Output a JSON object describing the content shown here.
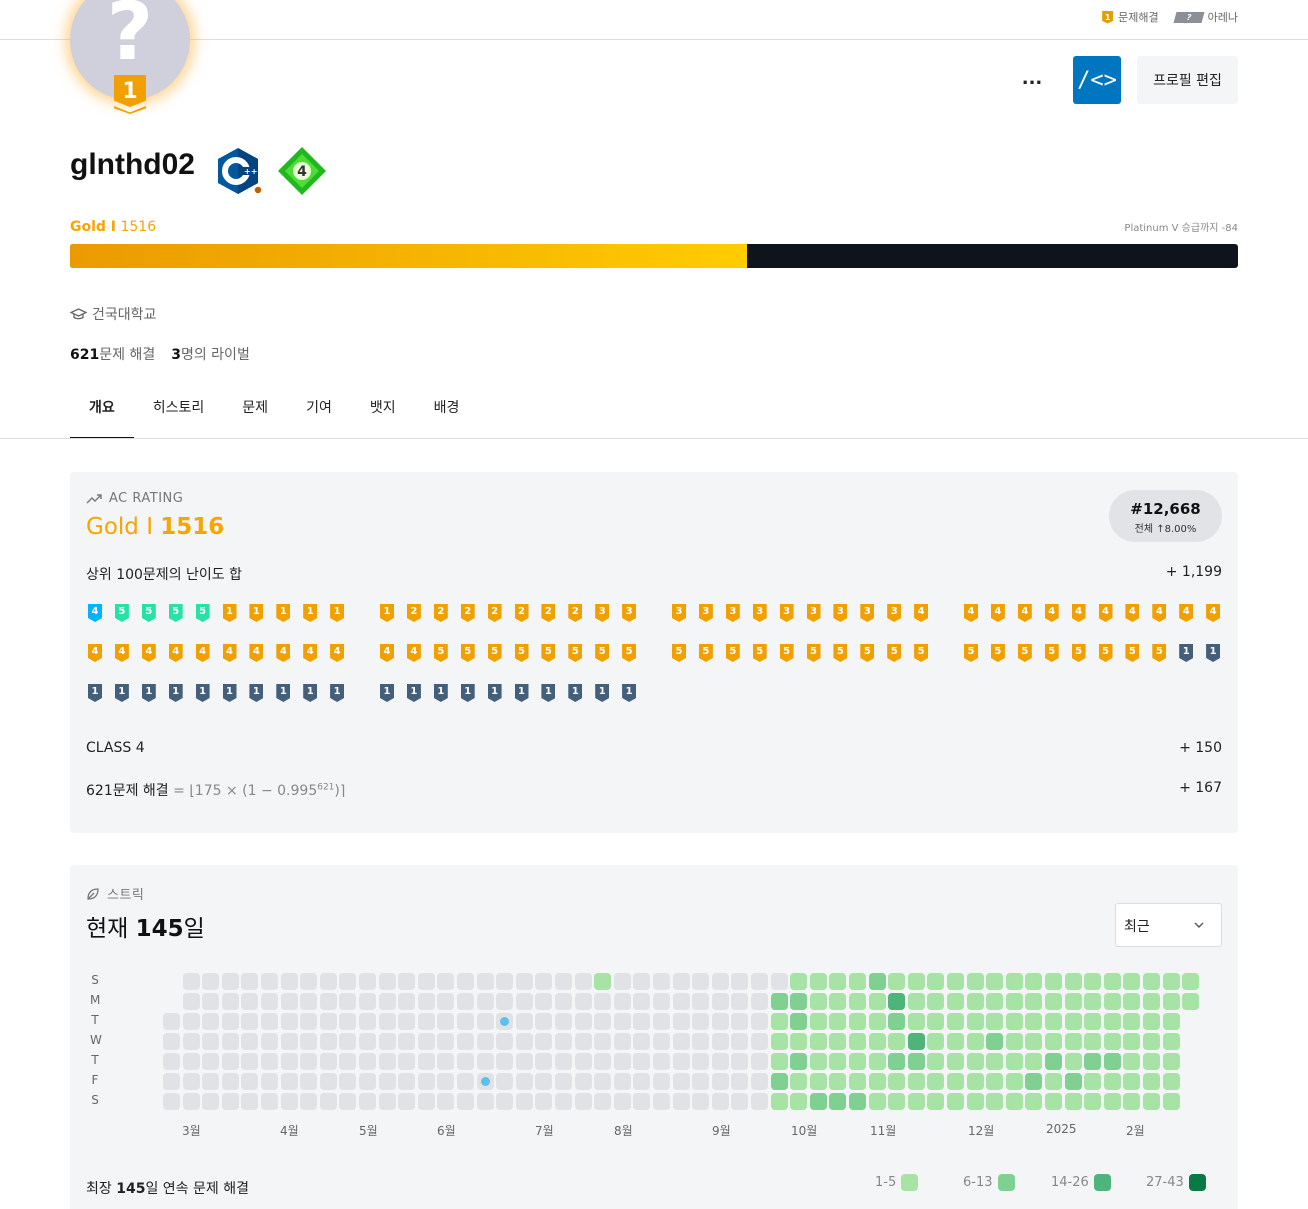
{
  "topbar": {
    "solve_tier": "1",
    "solve_label": "문제해결",
    "arena_tier": "?",
    "arena_label": "아레나"
  },
  "avatar": {
    "glyph": "?",
    "tier": "1"
  },
  "header": {
    "more_label": "...",
    "code_label": "/<>",
    "edit_label": "프로필 편집"
  },
  "profile": {
    "username": "glnthd02",
    "level_badge": "4",
    "tier_name": "Gold I",
    "tier_rating": "1516",
    "next_tier": "Platinum V 승급까지 -84",
    "progress_fraction": 0.58,
    "school": "건국대학교",
    "solved_count": "621",
    "solved_suffix": "문제 해결",
    "rival_count": "3",
    "rival_suffix": "명의 라이벌"
  },
  "tabs": [
    {
      "label": "개요",
      "active": true
    },
    {
      "label": "히스토리"
    },
    {
      "label": "문제"
    },
    {
      "label": "기여"
    },
    {
      "label": "뱃지"
    },
    {
      "label": "배경"
    }
  ],
  "ac_rating": {
    "section_title": "AC RATING",
    "tier_name": "Gold I",
    "tier_rating": "1516",
    "rank": "#12,668",
    "rank_sub": "전체 ↑8.00%",
    "top100_label": "상위 100문제의 난이도 합",
    "top100_value": "+ 1,199",
    "class_label": "CLASS 4",
    "class_value": "+ 150",
    "solved_label": "621문제 해결",
    "solved_formula": "= ⌊175 × (1 − 0.995",
    "solved_exp": "621",
    "solved_tail": ")⌉",
    "solved_value": "+ 167",
    "colors": {
      "gold": "#f0a000",
      "platinum": "#27e2a4",
      "diamond": "#00b4fc",
      "silver": "#435f7a"
    },
    "problem_tiers": [
      [
        [
          "d",
          4
        ],
        [
          "p",
          5
        ],
        [
          "p",
          5
        ],
        [
          "p",
          5
        ],
        [
          "p",
          5
        ],
        [
          "g",
          1
        ],
        [
          "g",
          1
        ],
        [
          "g",
          1
        ],
        [
          "g",
          1
        ],
        [
          "g",
          1
        ]
      ],
      [
        [
          "g",
          1
        ],
        [
          "g",
          2
        ],
        [
          "g",
          2
        ],
        [
          "g",
          2
        ],
        [
          "g",
          2
        ],
        [
          "g",
          2
        ],
        [
          "g",
          2
        ],
        [
          "g",
          2
        ],
        [
          "g",
          3
        ],
        [
          "g",
          3
        ]
      ],
      [
        [
          "g",
          3
        ],
        [
          "g",
          3
        ],
        [
          "g",
          3
        ],
        [
          "g",
          3
        ],
        [
          "g",
          3
        ],
        [
          "g",
          3
        ],
        [
          "g",
          3
        ],
        [
          "g",
          3
        ],
        [
          "g",
          3
        ],
        [
          "g",
          4
        ]
      ],
      [
        [
          "g",
          4
        ],
        [
          "g",
          4
        ],
        [
          "g",
          4
        ],
        [
          "g",
          4
        ],
        [
          "g",
          4
        ],
        [
          "g",
          4
        ],
        [
          "g",
          4
        ],
        [
          "g",
          4
        ],
        [
          "g",
          4
        ],
        [
          "g",
          4
        ]
      ],
      [
        [
          "g",
          4
        ],
        [
          "g",
          4
        ],
        [
          "g",
          4
        ],
        [
          "g",
          4
        ],
        [
          "g",
          4
        ],
        [
          "g",
          4
        ],
        [
          "g",
          4
        ],
        [
          "g",
          4
        ],
        [
          "g",
          4
        ],
        [
          "g",
          4
        ]
      ],
      [
        [
          "g",
          4
        ],
        [
          "g",
          4
        ],
        [
          "g",
          5
        ],
        [
          "g",
          5
        ],
        [
          "g",
          5
        ],
        [
          "g",
          5
        ],
        [
          "g",
          5
        ],
        [
          "g",
          5
        ],
        [
          "g",
          5
        ],
        [
          "g",
          5
        ]
      ],
      [
        [
          "g",
          5
        ],
        [
          "g",
          5
        ],
        [
          "g",
          5
        ],
        [
          "g",
          5
        ],
        [
          "g",
          5
        ],
        [
          "g",
          5
        ],
        [
          "g",
          5
        ],
        [
          "g",
          5
        ],
        [
          "g",
          5
        ],
        [
          "g",
          5
        ]
      ],
      [
        [
          "g",
          5
        ],
        [
          "g",
          5
        ],
        [
          "g",
          5
        ],
        [
          "g",
          5
        ],
        [
          "g",
          5
        ],
        [
          "g",
          5
        ],
        [
          "g",
          5
        ],
        [
          "g",
          5
        ],
        [
          "s",
          1
        ],
        [
          "s",
          1
        ]
      ],
      [
        [
          "s",
          1
        ],
        [
          "s",
          1
        ],
        [
          "s",
          1
        ],
        [
          "s",
          1
        ],
        [
          "s",
          1
        ],
        [
          "s",
          1
        ],
        [
          "s",
          1
        ],
        [
          "s",
          1
        ],
        [
          "s",
          1
        ],
        [
          "s",
          1
        ]
      ],
      [
        [
          "s",
          1
        ],
        [
          "s",
          1
        ],
        [
          "s",
          1
        ],
        [
          "s",
          1
        ],
        [
          "s",
          1
        ],
        [
          "s",
          1
        ],
        [
          "s",
          1
        ],
        [
          "s",
          1
        ],
        [
          "s",
          1
        ],
        [
          "s",
          1
        ]
      ]
    ]
  },
  "streak": {
    "section_title": "스트릭",
    "current_prefix": "현재 ",
    "current_days": "145",
    "current_suffix": "일",
    "dropdown_value": "최근",
    "weekdays": [
      "S",
      "M",
      "T",
      "W",
      "T",
      "F",
      "S"
    ],
    "months": [
      "3월",
      "4월",
      "5월",
      "6월",
      "7월",
      "8월",
      "9월",
      "10월",
      "11월",
      "12월",
      "2025",
      "2월"
    ],
    "longest_prefix": "최장 ",
    "longest_days": "145",
    "longest_suffix": "일 연속 문제 해결",
    "legend": [
      {
        "label": "1-5",
        "color": "#a6e3a5"
      },
      {
        "label": "6-13",
        "color": "#7fd091"
      },
      {
        "label": "14-26",
        "color": "#4fb479"
      },
      {
        "label": "27-43",
        "color": "#0a7a45"
      }
    ],
    "empty_color": "#e1e2e5",
    "freeze_color": "#5bc0eb",
    "week_count": 53,
    "first_day_week0": 2,
    "last_week_days": 2,
    "active_from_week": 31,
    "levels": {
      "31": [
        0,
        2,
        1,
        1,
        1,
        2,
        1
      ],
      "32": [
        1,
        2,
        2,
        1,
        2,
        1,
        1
      ],
      "34": [
        1,
        1,
        1,
        1,
        1,
        1,
        2
      ],
      "35": [
        1,
        1,
        1,
        1,
        1,
        1,
        2
      ],
      "36": [
        2,
        1,
        1,
        1,
        1,
        1,
        1
      ],
      "37": [
        1,
        3,
        2,
        1,
        2,
        1,
        1
      ],
      "38": [
        1,
        1,
        1,
        3,
        2,
        1,
        1
      ],
      "42": [
        1,
        1,
        1,
        2,
        1,
        1,
        1
      ],
      "44": [
        1,
        1,
        1,
        1,
        1,
        2,
        1
      ],
      "45": [
        1,
        1,
        1,
        1,
        2,
        1,
        1
      ],
      "46": [
        1,
        1,
        1,
        1,
        1,
        2,
        1
      ],
      "47": [
        1,
        1,
        1,
        1,
        2,
        1,
        1
      ],
      "48": [
        1,
        1,
        1,
        1,
        2,
        1,
        1
      ]
    },
    "single_cells": [
      {
        "week": 22,
        "day": 0,
        "level": 1
      },
      {
        "week": 36,
        "day": 0,
        "level": 2
      },
      {
        "week": 37,
        "day": 0,
        "level": 1
      },
      {
        "week": 33,
        "day": 6,
        "level": 2
      },
      {
        "week": 34,
        "day": 6,
        "level": 2
      }
    ],
    "freeze_cells": [
      {
        "week": 17,
        "day": 2
      },
      {
        "week": 16,
        "day": 5
      }
    ]
  }
}
